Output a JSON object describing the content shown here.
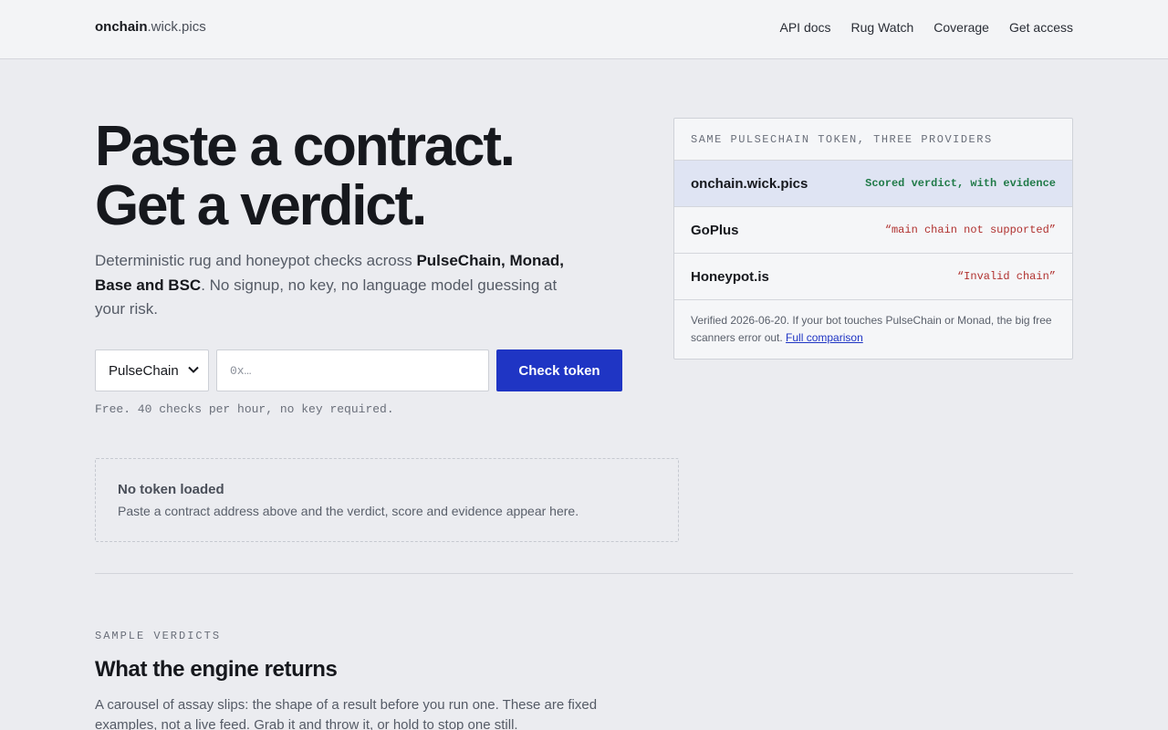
{
  "header": {
    "brand_strong": "onchain",
    "brand_rest": ".wick.pics",
    "nav": [
      "API docs",
      "Rug Watch",
      "Coverage",
      "Get access"
    ]
  },
  "hero": {
    "title_line1": "Paste a contract.",
    "title_line2": "Get a verdict.",
    "lede_part1": "Deterministic rug and honeypot checks across ",
    "lede_chains": "PulseChain, Monad, Base and BSC",
    "lede_part2": ". No signup, no key, no language model guessing at your risk."
  },
  "form": {
    "chain_selected": "PulseChain",
    "address_placeholder": "0x…",
    "address_value": "",
    "submit_label": "Check token",
    "note": "Free. 40 checks per hour, no key required."
  },
  "empty_state": {
    "title": "No token loaded",
    "text": "Paste a contract address above and the verdict, score and evidence appear here."
  },
  "comparison": {
    "heading": "SAME PULSECHAIN TOKEN, THREE PROVIDERS",
    "rows": [
      {
        "provider": "onchain.wick.pics",
        "result": "Scored verdict, with evidence"
      },
      {
        "provider": "GoPlus",
        "result": "“main chain not supported”"
      },
      {
        "provider": "Honeypot.is",
        "result": "“Invalid chain”"
      }
    ],
    "footer_text": "Verified 2026-06-20. If your bot touches PulseChain or Monad, the big free scanners error out. ",
    "footer_link": "Full comparison"
  },
  "samples": {
    "eyebrow": "SAMPLE VERDICTS",
    "title": "What the engine returns",
    "text": "A carousel of assay slips: the shape of a result before you run one. These are fixed examples, not a live feed. Grab it and throw it, or hold to stop one still."
  },
  "colors": {
    "accent": "#1f35c4",
    "good": "#207a48",
    "bad": "#b0312f",
    "background": "#ebecf0"
  }
}
